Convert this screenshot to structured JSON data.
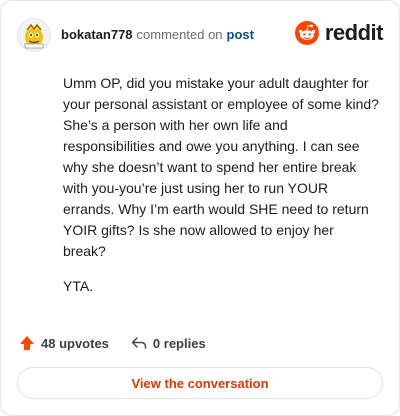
{
  "comment": {
    "username": "bokatan778",
    "action_text": "commented on",
    "post_link_text": "post",
    "paragraphs": [
      "Umm OP, did you mistake your adult daughter for your personal assistant or employee of some kind? She’s a person with her own life and responsibilities and owe you anything. I can see why she doesn’t want to spend her entire break with you-you’re just using her to run YOUR errands. Why I’m earth would SHE need to return YOIR gifts? Is she now allowed to enjoy her break?",
      "YTA."
    ]
  },
  "brand": {
    "wordmark": "reddit",
    "icon": "reddit-snoo-icon",
    "color": "#ff4500"
  },
  "footer": {
    "upvotes_label": "48 upvotes",
    "upvote_icon": "upvote-arrow-icon",
    "replies_label": "0 replies",
    "reply_icon": "reply-arrow-icon",
    "upvote_color": "#ff4500"
  },
  "cta": {
    "label": "View the conversation",
    "color": "#d93a00"
  }
}
